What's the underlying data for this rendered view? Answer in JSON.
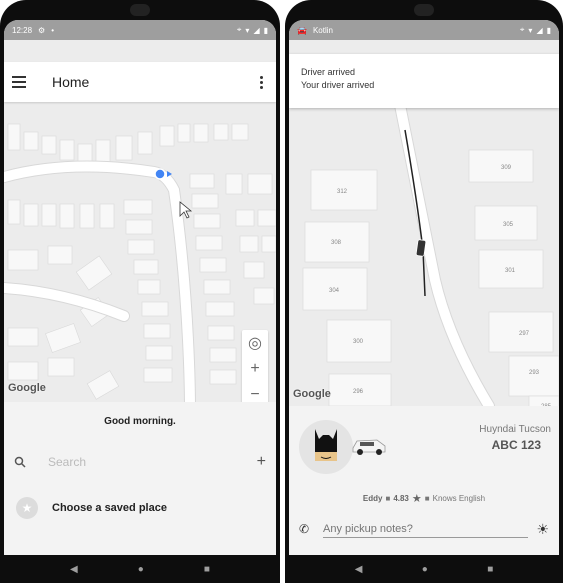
{
  "left": {
    "status_time": "12:28",
    "appbar_title": "Home",
    "greeting": "Good morning.",
    "search_placeholder": "Search",
    "saved_place": "Choose a saved place",
    "google_logo": "Google"
  },
  "right": {
    "status_app": "Kotlin",
    "notification_title": "Driver arrived",
    "notification_body": "Your driver arrived",
    "house_numbers": [
      "309",
      "312",
      "305",
      "308",
      "301",
      "304",
      "297",
      "300",
      "293",
      "296",
      "285"
    ],
    "google_logo": "Google",
    "car_model": "Huyndai Tucson",
    "plate": "ABC 123",
    "driver_name": "Eddy",
    "rating": "4.83",
    "language": "Knows English",
    "notes_placeholder": "Any pickup notes?"
  },
  "icons": {
    "menu": "hamburger-menu-icon",
    "more": "more-vert-icon",
    "search": "search-icon",
    "add": "plus-icon",
    "star": "star-icon",
    "location": "my-location-icon",
    "phone": "phone-icon",
    "sun": "brightness-icon",
    "nav_back": "back-triangle-icon",
    "nav_home": "home-circle-icon",
    "nav_recent": "recent-square-icon"
  },
  "colors": {
    "location_dot": "#4285f4",
    "route": "#222222",
    "status_bar": "#9e9e9e"
  }
}
